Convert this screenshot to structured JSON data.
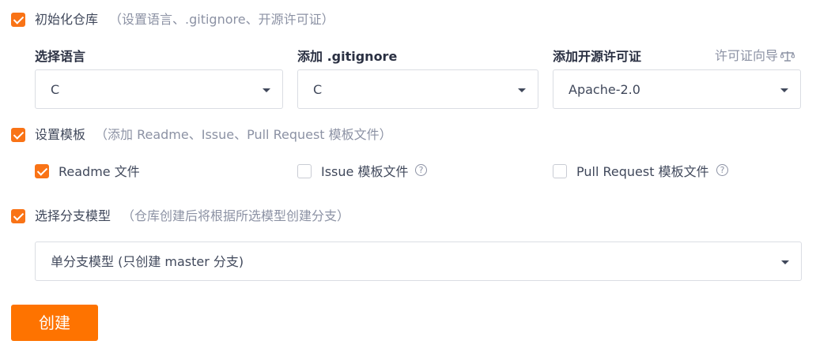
{
  "init_repo": {
    "label": "初始化仓库",
    "hint": "（设置语言、.gitignore、开源许可证）",
    "checked": true,
    "language": {
      "label": "选择语言",
      "value": "C"
    },
    "gitignore": {
      "label": "添加 .gitignore",
      "value": "C"
    },
    "license": {
      "label": "添加开源许可证",
      "value": "Apache-2.0",
      "guide_link": "许可证向导"
    }
  },
  "template": {
    "label": "设置模板",
    "hint": "（添加 Readme、Issue、Pull Request 模板文件）",
    "checked": true,
    "options": [
      {
        "label": "Readme 文件",
        "checked": true
      },
      {
        "label": "Issue 模板文件",
        "checked": false
      },
      {
        "label": "Pull Request 模板文件",
        "checked": false
      }
    ]
  },
  "branch_model": {
    "label": "选择分支模型",
    "hint": "（仓库创建后将根据所选模型创建分支）",
    "checked": true,
    "value": "单分支模型 (只创建 master 分支)"
  },
  "create_button": "创建",
  "colors": {
    "accent": "#f97316",
    "button": "#fe7300",
    "hint": "#8c92a4"
  },
  "icons": {
    "help": "question-circle-icon",
    "license_guide": "scale-icon",
    "dropdown": "caret-down-icon"
  }
}
